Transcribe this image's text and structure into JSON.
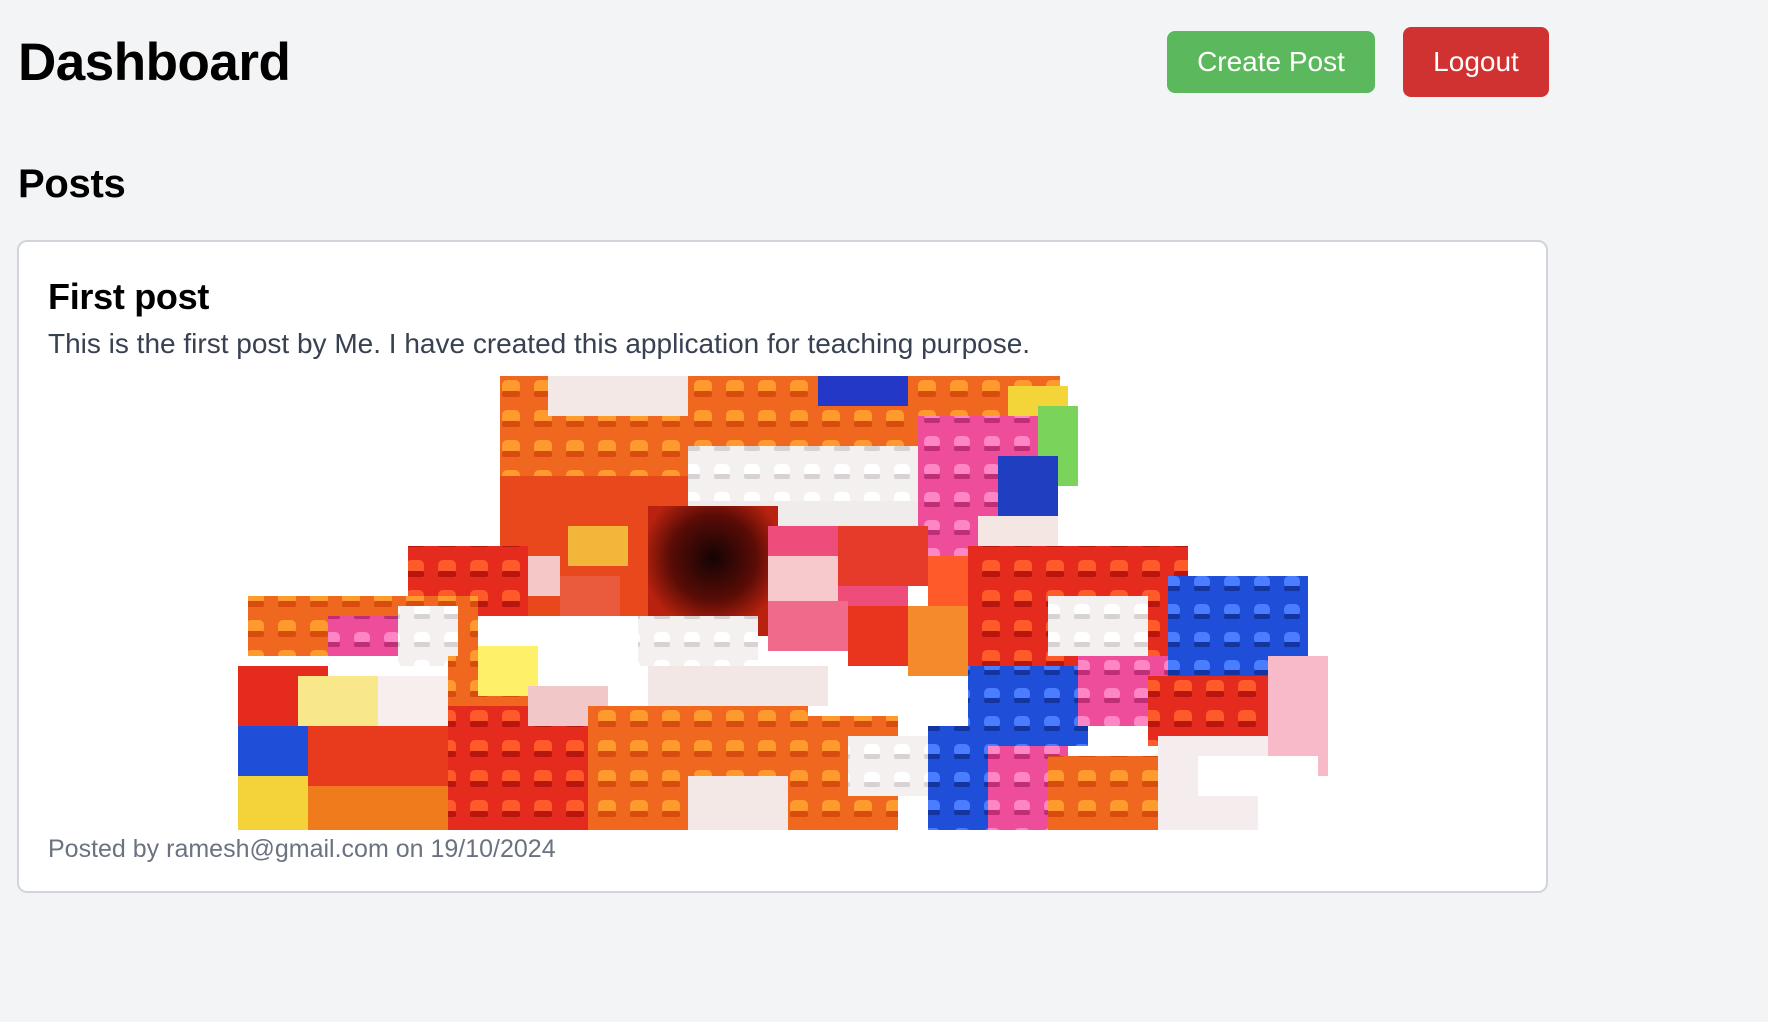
{
  "header": {
    "title": "Dashboard",
    "create_post_label": "Create Post",
    "logout_label": "Logout"
  },
  "colors": {
    "create_button": "#5cb85c",
    "logout_button": "#d03231",
    "card_border": "#d1d5db"
  },
  "posts_section": {
    "title": "Posts"
  },
  "posts": [
    {
      "title": "First post",
      "body": "This is the first post by Me. I have created this application for teaching purpose.",
      "image_alt": "colorful-building-blocks-photo",
      "meta": "Posted by ramesh@gmail.com on 19/10/2024"
    }
  ]
}
